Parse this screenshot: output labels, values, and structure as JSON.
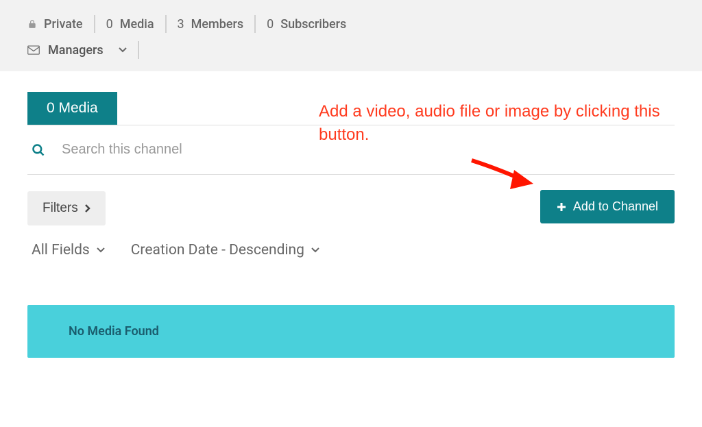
{
  "header": {
    "privacy_label": "Private",
    "media_count": "0",
    "media_label": "Media",
    "members_count": "3",
    "members_label": "Members",
    "subscribers_count": "0",
    "subscribers_label": "Subscribers",
    "managers_label": "Managers"
  },
  "tab": {
    "label": "0 Media"
  },
  "search": {
    "placeholder": "Search this channel"
  },
  "filters": {
    "button_label": "Filters"
  },
  "sort": {
    "field_label": "All Fields",
    "order_label": "Creation Date - Descending"
  },
  "add_button": {
    "label": "Add to Channel"
  },
  "annotation": {
    "text": "Add a video, audio file or image by clicking this button."
  },
  "banner": {
    "no_media": "No Media Found"
  }
}
